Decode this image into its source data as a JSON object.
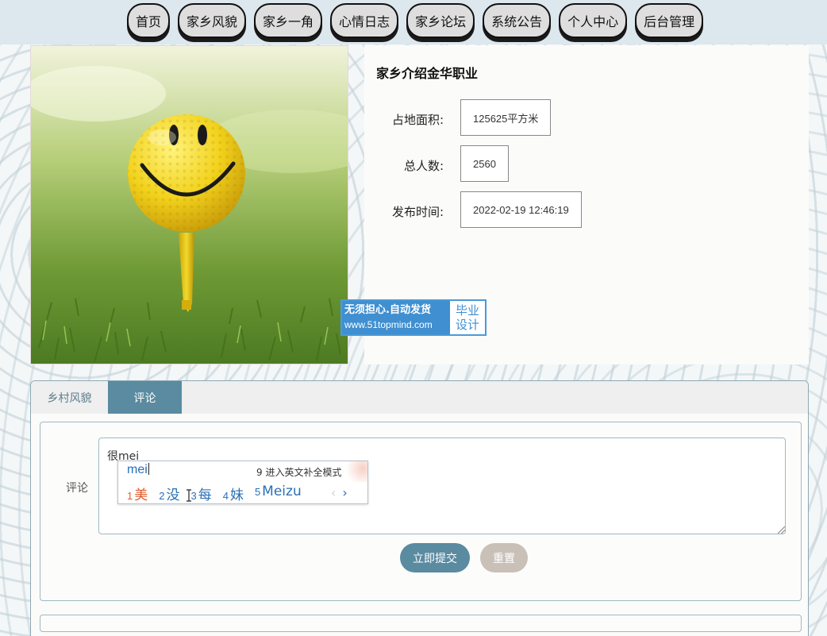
{
  "nav": {
    "items": [
      "首页",
      "家乡风貌",
      "家乡一角",
      "心情日志",
      "家乡论坛",
      "系统公告",
      "个人中心",
      "后台管理"
    ]
  },
  "detail": {
    "title": "家乡介绍金华职业",
    "fields": [
      {
        "label": "占地面积:",
        "value": "125625平方米"
      },
      {
        "label": "总人数:",
        "value": "2560"
      },
      {
        "label": "发布时间:",
        "value": "2022-02-19 12:46:19"
      }
    ]
  },
  "watermark": {
    "line1": "无须担心.自动发货",
    "line2": "www.51topmind.com",
    "right1": "毕业",
    "right2": "设计"
  },
  "tabs": [
    "乡村风貌",
    "评论"
  ],
  "comment": {
    "label": "评论",
    "value": "很mei",
    "submit": "立即提交",
    "reset": "重置"
  },
  "ime": {
    "input": "mei",
    "hint": "9 进入英文补全模式",
    "candidates": [
      {
        "num": "1",
        "text": "美"
      },
      {
        "num": "2",
        "text": "没"
      },
      {
        "num": "3",
        "text": "每"
      },
      {
        "num": "4",
        "text": "妹"
      },
      {
        "num": "5",
        "text": "Meizu"
      }
    ],
    "prev": "‹",
    "next": "›"
  },
  "colors": {
    "accent": "#5a8ba0",
    "reset": "#c9c0b8",
    "watermark": "#3f8fd1"
  }
}
